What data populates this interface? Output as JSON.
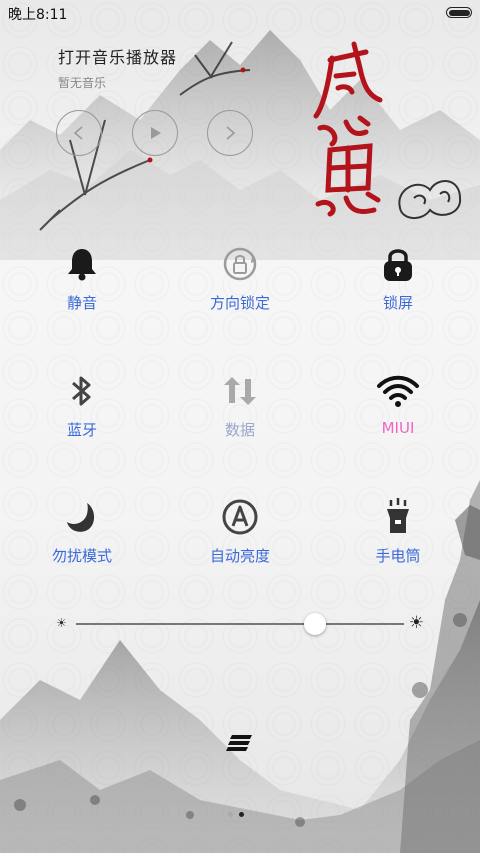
{
  "status_bar": {
    "time": "晚上8:11",
    "battery_level": 1.0
  },
  "music": {
    "title": "打开音乐播放器",
    "subtitle": "暂无音乐"
  },
  "controls": [
    {
      "name": "previous",
      "icon": "prev-icon"
    },
    {
      "name": "play",
      "icon": "play-icon"
    },
    {
      "name": "next",
      "icon": "next-icon"
    }
  ],
  "toggles": [
    {
      "label": "静音",
      "icon": "bell-icon",
      "state": "off"
    },
    {
      "label": "方向锁定",
      "icon": "rotation-lock-icon",
      "state": "off"
    },
    {
      "label": "锁屏",
      "icon": "lock-icon",
      "state": "off"
    },
    {
      "label": "蓝牙",
      "icon": "bluetooth-icon",
      "state": "off"
    },
    {
      "label": "数据",
      "icon": "data-icon",
      "state": "disabled"
    },
    {
      "label": "MIUI",
      "icon": "wifi-icon",
      "state": "on"
    },
    {
      "label": "勿扰模式",
      "icon": "moon-icon",
      "state": "off"
    },
    {
      "label": "自动亮度",
      "icon": "auto-brightness-icon",
      "state": "off"
    },
    {
      "label": "手电筒",
      "icon": "flashlight-icon",
      "state": "off"
    }
  ],
  "brightness": {
    "level": 0.73
  },
  "pages": {
    "count": 2,
    "current": 2
  },
  "colors": {
    "label_blue": "#3b6ad8",
    "label_gray": "#9aa7cc",
    "label_pink": "#ee66c4",
    "calligraphy_red": "#b3141b"
  }
}
